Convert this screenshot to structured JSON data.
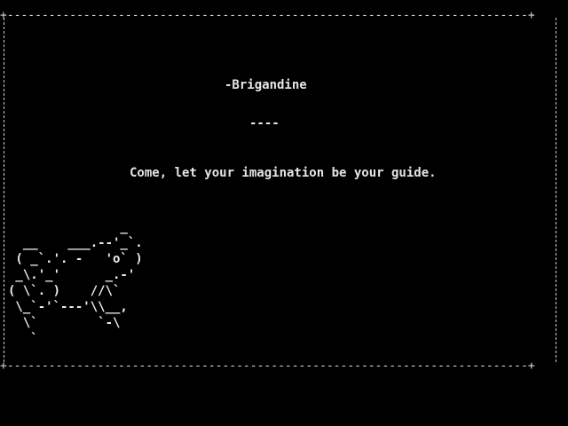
{
  "screen": {
    "border_top": "+---------------------------------------------------------------------------+",
    "border_bottom": "+---------------------------------------------------------------------------+",
    "title": "-Brigandine",
    "divider": "----",
    "tagline": "Come, let your imagination be your guide.",
    "ascii_art": "               _\n  __    ___.--'_`.\n ( _`.'. -   'o` )\n _\\.'_'      _.-'\n( \\`. )    //\\`\n \\_`-'`---'\\\\__,\n  \\`        `-\\\n   `"
  },
  "colors": {
    "background": "#000000",
    "foreground": "#e6e6e6"
  }
}
